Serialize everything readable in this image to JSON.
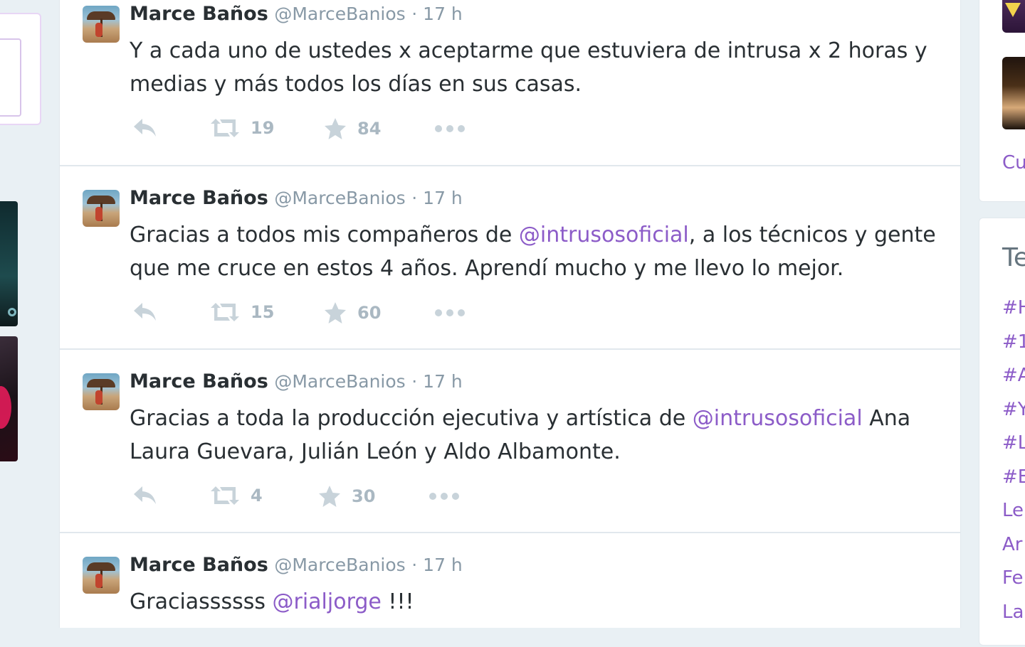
{
  "tweets": [
    {
      "name": "Marce Baños",
      "handle": "@MarceBanios",
      "time": "· 17 h",
      "text_parts": [
        {
          "t": "Y a cada uno de ustedes x aceptarme que estuviera de intrusa x 2 horas y medias y más todos los días en sus casas."
        }
      ],
      "retweets": "19",
      "favorites": "84"
    },
    {
      "name": "Marce Baños",
      "handle": "@MarceBanios",
      "time": "· 17 h",
      "text_parts": [
        {
          "t": "Gracias a todos mis compañeros de "
        },
        {
          "m": "@intrusosoficial"
        },
        {
          "t": ", a los técnicos y gente que me cruce en estos 4 años. Aprendí mucho y me llevo lo mejor."
        }
      ],
      "retweets": "15",
      "favorites": "60"
    },
    {
      "name": "Marce Baños",
      "handle": "@MarceBanios",
      "time": "· 17 h",
      "text_parts": [
        {
          "t": "Gracias a toda la producción ejecutiva y artística de "
        },
        {
          "m": "@intrusosoficial"
        },
        {
          "t": " Ana Laura Guevara, Julián León y Aldo Albamonte."
        }
      ],
      "retweets": "4",
      "favorites": "30"
    },
    {
      "name": "Marce Baños",
      "handle": "@MarceBanios",
      "time": "· 17 h",
      "text_parts": [
        {
          "t": "Graciassssss "
        },
        {
          "m": "@rialjorge"
        },
        {
          "t": " !!!"
        }
      ]
    }
  ],
  "right_column": {
    "link_fragment": "Cu",
    "trends_title_fragment": "Te",
    "trend_fragments": [
      "#H",
      "#1",
      "#A",
      "#Y",
      "#L",
      "#E",
      "Le",
      "Ar",
      "Fe",
      "La"
    ]
  },
  "icons": {
    "reply": "reply-icon",
    "retweet": "retweet-icon",
    "favorite": "star-icon",
    "more": "more-dots-icon"
  },
  "colors": {
    "mention": "#8c5cc8",
    "muted": "#8899a6",
    "action": "#aab8c2"
  }
}
